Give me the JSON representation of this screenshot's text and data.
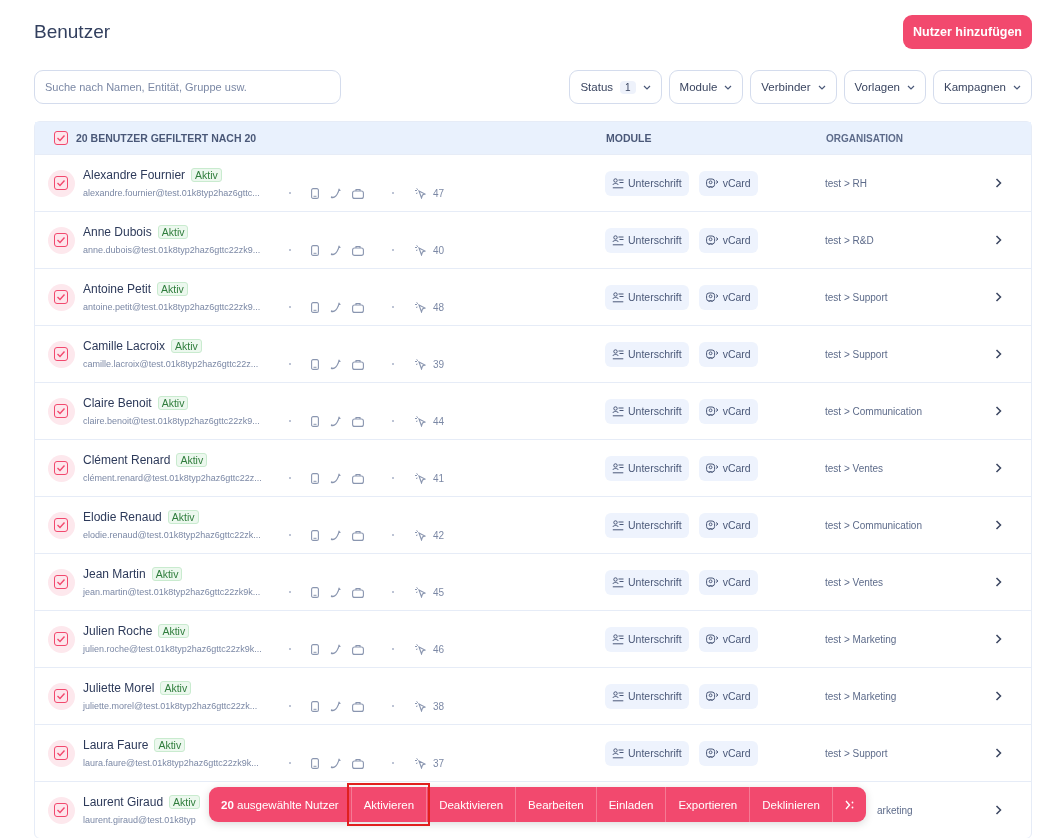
{
  "page": {
    "title": "Benutzer",
    "add_button": "Nutzer hinzufügen"
  },
  "search": {
    "placeholder": "Suche nach Namen, Entität, Gruppe usw."
  },
  "filters": [
    {
      "label": "Status",
      "count": "1"
    },
    {
      "label": "Module"
    },
    {
      "label": "Verbinder"
    },
    {
      "label": "Vorlagen"
    },
    {
      "label": "Kampagnen"
    }
  ],
  "table": {
    "select_all": {
      "checked": true
    },
    "summary": "20 BENUTZER GEFILTERT NACH 20",
    "columns": [
      {
        "label": "MODULE"
      },
      {
        "label": "ORGANISATION"
      }
    ],
    "rows": [
      {
        "kind": "full",
        "checked": true,
        "name": "Alexandre Fournier",
        "status": "Aktiv",
        "email": "alexandre.fournier@test.01k8typ2haz6gttc...",
        "count": "47",
        "modules": [
          {
            "kind": "signature",
            "label": "Unterschrift"
          },
          {
            "kind": "vcard",
            "label": "vCard"
          }
        ],
        "org": "test > RH"
      },
      {
        "kind": "full",
        "checked": true,
        "name": "Anne Dubois",
        "status": "Aktiv",
        "email": "anne.dubois@test.01k8typ2haz6gttc22zk9...",
        "count": "40",
        "modules": [
          {
            "kind": "signature",
            "label": "Unterschrift"
          },
          {
            "kind": "vcard",
            "label": "vCard"
          }
        ],
        "org": "test > R&D"
      },
      {
        "kind": "full",
        "checked": true,
        "name": "Antoine Petit",
        "status": "Aktiv",
        "email": "antoine.petit@test.01k8typ2haz6gttc22zk9...",
        "count": "48",
        "modules": [
          {
            "kind": "signature",
            "label": "Unterschrift"
          },
          {
            "kind": "vcard",
            "label": "vCard"
          }
        ],
        "org": "test > Support"
      },
      {
        "kind": "full",
        "checked": true,
        "name": "Camille Lacroix",
        "status": "Aktiv",
        "email": "camille.lacroix@test.01k8typ2haz6gttc22z...",
        "count": "39",
        "modules": [
          {
            "kind": "signature",
            "label": "Unterschrift"
          },
          {
            "kind": "vcard",
            "label": "vCard"
          }
        ],
        "org": "test > Support"
      },
      {
        "kind": "full",
        "checked": true,
        "name": "Claire Benoit",
        "status": "Aktiv",
        "email": "claire.benoit@test.01k8typ2haz6gttc22zk9...",
        "count": "44",
        "modules": [
          {
            "kind": "signature",
            "label": "Unterschrift"
          },
          {
            "kind": "vcard",
            "label": "vCard"
          }
        ],
        "org": "test > Communication"
      },
      {
        "kind": "full",
        "checked": true,
        "name": "Clément Renard",
        "status": "Aktiv",
        "email": "clément.renard@test.01k8typ2haz6gttc22z...",
        "count": "41",
        "modules": [
          {
            "kind": "signature",
            "label": "Unterschrift"
          },
          {
            "kind": "vcard",
            "label": "vCard"
          }
        ],
        "org": "test > Ventes"
      },
      {
        "kind": "full",
        "checked": true,
        "name": "Elodie Renaud",
        "status": "Aktiv",
        "email": "elodie.renaud@test.01k8typ2haz6gttc22zk...",
        "count": "42",
        "modules": [
          {
            "kind": "signature",
            "label": "Unterschrift"
          },
          {
            "kind": "vcard",
            "label": "vCard"
          }
        ],
        "org": "test > Communication"
      },
      {
        "kind": "full",
        "checked": true,
        "name": "Jean Martin",
        "status": "Aktiv",
        "email": "jean.martin@test.01k8typ2haz6gttc22zk9k...",
        "count": "45",
        "modules": [
          {
            "kind": "signature",
            "label": "Unterschrift"
          },
          {
            "kind": "vcard",
            "label": "vCard"
          }
        ],
        "org": "test > Ventes"
      },
      {
        "kind": "full",
        "checked": true,
        "name": "Julien Roche",
        "status": "Aktiv",
        "email": "julien.roche@test.01k8typ2haz6gttc22zk9k...",
        "count": "46",
        "modules": [
          {
            "kind": "signature",
            "label": "Unterschrift"
          },
          {
            "kind": "vcard",
            "label": "vCard"
          }
        ],
        "org": "test > Marketing"
      },
      {
        "kind": "full",
        "checked": true,
        "name": "Juliette Morel",
        "status": "Aktiv",
        "email": "juliette.morel@test.01k8typ2haz6gttc22zk...",
        "count": "38",
        "modules": [
          {
            "kind": "signature",
            "label": "Unterschrift"
          },
          {
            "kind": "vcard",
            "label": "vCard"
          }
        ],
        "org": "test > Marketing"
      },
      {
        "kind": "full",
        "checked": true,
        "name": "Laura Faure",
        "status": "Aktiv",
        "email": "laura.faure@test.01k8typ2haz6gttc22zk9k...",
        "count": "37",
        "modules": [
          {
            "kind": "signature",
            "label": "Unterschrift"
          },
          {
            "kind": "vcard",
            "label": "vCard"
          }
        ],
        "org": "test > Support"
      },
      {
        "kind": "covered",
        "checked": true,
        "name": "Laurent Giraud",
        "status": "Aktiv",
        "email": "laurent.giraud@test.01k8typ",
        "org": "arketing"
      }
    ]
  },
  "bulk_bar": {
    "count": "20",
    "label": "ausgewählte Nutzer",
    "actions": [
      {
        "label": "Aktivieren",
        "highlighted": true
      },
      {
        "label": "Deaktivieren",
        "highlighted": false
      },
      {
        "label": "Bearbeiten",
        "highlighted": false
      },
      {
        "label": "Einladen",
        "highlighted": false
      },
      {
        "label": "Exportieren",
        "highlighted": false
      },
      {
        "label": "Deklinieren",
        "highlighted": false
      }
    ]
  }
}
